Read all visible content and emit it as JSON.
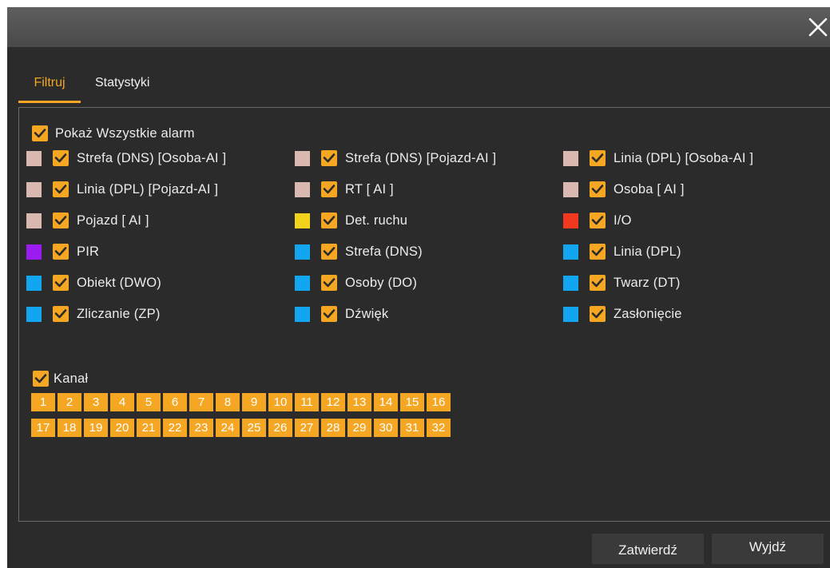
{
  "tabs": [
    "Filtruj",
    "Statystyki"
  ],
  "show_all": {
    "label": "Pokaż Wszystkie alarm",
    "checked": true
  },
  "alarm_types": [
    {
      "label": "Strefa (DNS) [Osoba-AI ]",
      "color": "#d9b8b0",
      "checked": true
    },
    {
      "label": "Strefa (DNS) [Pojazd-AI ]",
      "color": "#d9b8b0",
      "checked": true
    },
    {
      "label": "Linia (DPL) [Osoba-AI ]",
      "color": "#d9b8b0",
      "checked": true
    },
    {
      "label": "Linia (DPL) [Pojazd-AI ]",
      "color": "#d9b8b0",
      "checked": true
    },
    {
      "label": "RT  [ AI ]",
      "color": "#d9b8b0",
      "checked": true
    },
    {
      "label": "Osoba  [ AI ]",
      "color": "#d9b8b0",
      "checked": true
    },
    {
      "label": "Pojazd  [ AI ]",
      "color": "#d9b8b0",
      "checked": true
    },
    {
      "label": "Det. ruchu",
      "color": "#f2d21a",
      "checked": true
    },
    {
      "label": "I/O",
      "color": "#f0391f",
      "checked": true
    },
    {
      "label": "PIR",
      "color": "#9b1bf0",
      "checked": true
    },
    {
      "label": "Strefa (DNS)",
      "color": "#12a6f0",
      "checked": true
    },
    {
      "label": "Linia (DPL)",
      "color": "#12a6f0",
      "checked": true
    },
    {
      "label": "Obiekt (DWO)",
      "color": "#12a6f0",
      "checked": true
    },
    {
      "label": "Osoby (DO)",
      "color": "#12a6f0",
      "checked": true
    },
    {
      "label": "Twarz (DT)",
      "color": "#12a6f0",
      "checked": true
    },
    {
      "label": "Zliczanie (ZP)",
      "color": "#12a6f0",
      "checked": true
    },
    {
      "label": "Dźwięk",
      "color": "#12a6f0",
      "checked": true
    },
    {
      "label": "Zasłonięcie",
      "color": "#12a6f0",
      "checked": true
    }
  ],
  "channel": {
    "label": "Kanał",
    "checked": true,
    "numbers": [
      "1",
      "2",
      "3",
      "4",
      "5",
      "6",
      "7",
      "8",
      "9",
      "10",
      "11",
      "12",
      "13",
      "14",
      "15",
      "16",
      "17",
      "18",
      "19",
      "20",
      "21",
      "22",
      "23",
      "24",
      "25",
      "26",
      "27",
      "28",
      "29",
      "30",
      "31",
      "32"
    ]
  },
  "buttons": {
    "confirm": "Zatwierdź",
    "exit": "Wyjdź"
  },
  "colors": {
    "accent": "#f5a623",
    "background": "#2b2b2b",
    "titlebar": "#505050"
  },
  "icons": {
    "close": "close-icon",
    "check": "checkmark-icon"
  }
}
